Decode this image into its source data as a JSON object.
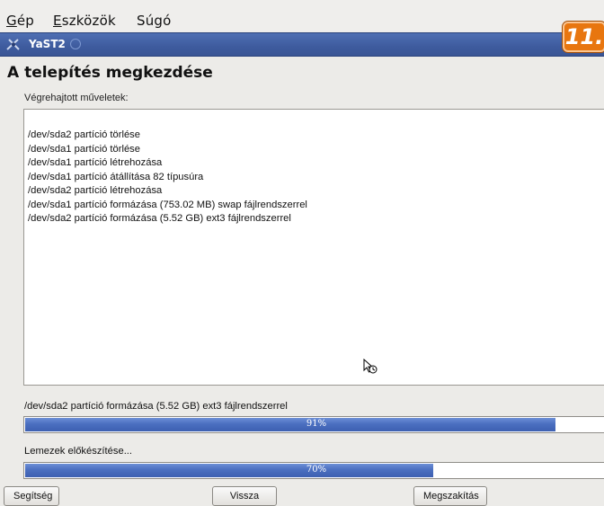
{
  "menubar": {
    "items": [
      {
        "accel": "G",
        "rest": "ép"
      },
      {
        "accel": "E",
        "rest": "szközök"
      },
      {
        "accel": "",
        "rest": "Súgó"
      }
    ]
  },
  "window": {
    "title": "YaST2",
    "badge": "11."
  },
  "page": {
    "title": "A telepítés megkezdése",
    "log_label": "Végrehajtott műveletek:",
    "log_lines": [
      "/dev/sda2 partíció törlése",
      "/dev/sda1 partíció törlése",
      "/dev/sda1 partíció létrehozása",
      "/dev/sda1 partíció átállítása 82 típusúra",
      "/dev/sda2 partíció létrehozása",
      "/dev/sda1 partíció formázása (753.02 MB) swap fájlrendszerrel",
      "/dev/sda2 partíció formázása (5.52 GB) ext3 fájlrendszerrel"
    ]
  },
  "progress": {
    "current_step_label": "/dev/sda2 partíció formázása (5.52 GB) ext3 fájlrendszerrel",
    "current_percent": 91,
    "current_text": "91%",
    "overall_label": "Lemezek előkészítése...",
    "overall_percent": 70,
    "overall_text": "70%"
  },
  "buttons": {
    "help": "Segítség",
    "back": "Vissza",
    "abort": "Megszakítás"
  },
  "colors": {
    "titlebar": "#3e5b9e",
    "progress_fill": "#4b6fc0",
    "badge": "#e8760f"
  }
}
